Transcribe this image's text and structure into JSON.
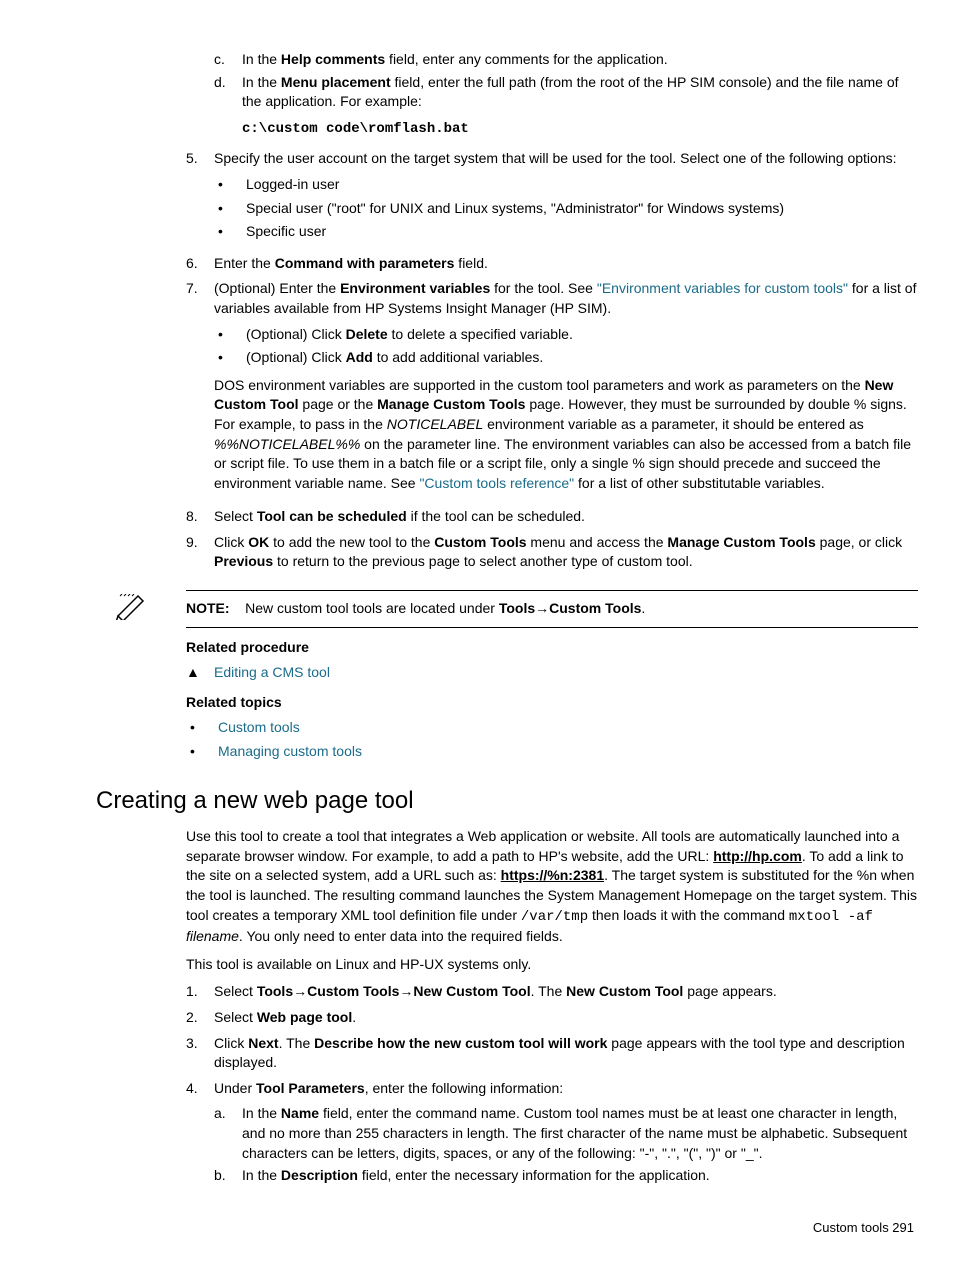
{
  "step_c_pre": "In the ",
  "step_c_bold": "Help comments",
  "step_c_post": " field, enter any comments for the application.",
  "step_d_pre": "In the ",
  "step_d_bold": "Menu placement",
  "step_d_post": " field, enter the full path (from the root of the HP SIM console) and the file name of the application. For example:",
  "code_path": "c:\\custom code\\romflash.bat",
  "step5": "Specify the user account on the target system that will be used for the tool. Select one of the following options:",
  "b1": "Logged-in user",
  "b2": "Special user (\"root\" for UNIX and Linux systems, \"Administrator\" for Windows systems)",
  "b3": "Specific user",
  "step6_pre": "Enter the ",
  "step6_bold": "Command with parameters",
  "step6_post": " field.",
  "step7_pre": "(Optional) Enter the ",
  "step7_bold": "Environment variables",
  "step7_mid": " for the tool. See ",
  "step7_link": "\"Environment variables for custom tools\"",
  "step7_post": " for a list of variables available from HP Systems Insight Manager (HP SIM).",
  "s7b1_pre": "(Optional) Click ",
  "s7b1_bold": "Delete",
  "s7b1_post": " to delete a specified variable.",
  "s7b2_pre": "(Optional) Click ",
  "s7b2_bold": "Add",
  "s7b2_post": " to add additional variables.",
  "dos_p1": "DOS environment variables are supported in the custom tool parameters and work as parameters on the ",
  "dos_b1": "New Custom Tool",
  "dos_p2": " page or the ",
  "dos_b2": "Manage Custom Tools",
  "dos_p3": " page. However, they must be surrounded by double % signs. For example, to pass in the ",
  "dos_i1": "NOTICELABEL",
  "dos_p4": " environment variable as a parameter, it should be entered as ",
  "dos_i2": "%%NOTICELABEL%%",
  "dos_p5": " on the parameter line. The environment variables can also be accessed from a batch file or script file. To use them in a batch file or a script file, only a single % sign should precede and succeed the environment variable name. See ",
  "dos_link": "\"Custom tools reference\"",
  "dos_p6": " for a list of other substitutable variables.",
  "step8_pre": "Select ",
  "step8_bold": "Tool can be scheduled",
  "step8_post": " if the tool can be scheduled.",
  "step9_p1": "Click ",
  "step9_b1": "OK",
  "step9_p2": " to add the new tool to the ",
  "step9_b2": "Custom Tools",
  "step9_p3": " menu and access the ",
  "step9_b3": "Manage Custom Tools",
  "step9_p4": " page, or click ",
  "step9_b4": "Previous",
  "step9_p5": " to return to the previous page to select another type of custom tool.",
  "note_label": "NOTE:",
  "note_text_pre": "New custom tool tools are located under ",
  "note_b1": "Tools",
  "note_arrow": "→",
  "note_b2": "Custom Tools",
  "note_text_post": ".",
  "rel_proc": "Related procedure",
  "rel_proc_item": "Editing a CMS tool",
  "rel_topics": "Related topics",
  "rel_t1": "Custom tools",
  "rel_t2": "Managing custom tools",
  "h2": "Creating a new web page tool",
  "intro_p1": "Use this tool to create a tool that integrates a Web application or website. All tools are automatically launched into a separate browser window. For example, to add a path to HP's website, add the URL: ",
  "intro_url1": "http://hp.com",
  "intro_p2": ". To add a link to the site on a selected system, add a URL such as: ",
  "intro_url2": "https://%n:2381",
  "intro_p3": ". The target system is substituted for the %n when the tool is launched. The resulting command launches the System Management Homepage on the target system. This tool creates a temporary XML tool definition file under ",
  "intro_mono1": "/var/tmp",
  "intro_p4": " then loads it with the command ",
  "intro_mono2": "mxtool -af",
  "intro_i1": " filename",
  "intro_p5": ". You only need to enter data into the required fields.",
  "avail": "This tool is available on Linux and HP-UX systems only.",
  "w1_pre": "Select ",
  "w1_b1": "Tools",
  "w1_b2": "Custom Tools",
  "w1_b3": "New Custom Tool",
  "w1_mid": ". The ",
  "w1_b4": "New Custom Tool",
  "w1_post": " page appears.",
  "w2_pre": "Select ",
  "w2_b": "Web page tool",
  "w2_post": ".",
  "w3_p1": "Click ",
  "w3_b1": "Next",
  "w3_p2": ". The ",
  "w3_b2": "Describe how the new custom tool will work",
  "w3_p3": " page appears with the tool type and description displayed.",
  "w4_pre": "Under ",
  "w4_b": "Tool Parameters",
  "w4_post": ", enter the following information:",
  "w4a_pre": "In the ",
  "w4a_b": "Name",
  "w4a_post": " field, enter the command name. Custom tool names must be at least one character in length, and no more than 255 characters in length. The first character of the name must be alphabetic. Subsequent characters can be letters, digits, spaces, or any of the following: \"-\", \".\", \"(\", \")\" or \"_\".",
  "w4b_pre": "In the ",
  "w4b_b": "Description",
  "w4b_post": " field, enter the necessary information for the application.",
  "footer": "Custom tools   291"
}
